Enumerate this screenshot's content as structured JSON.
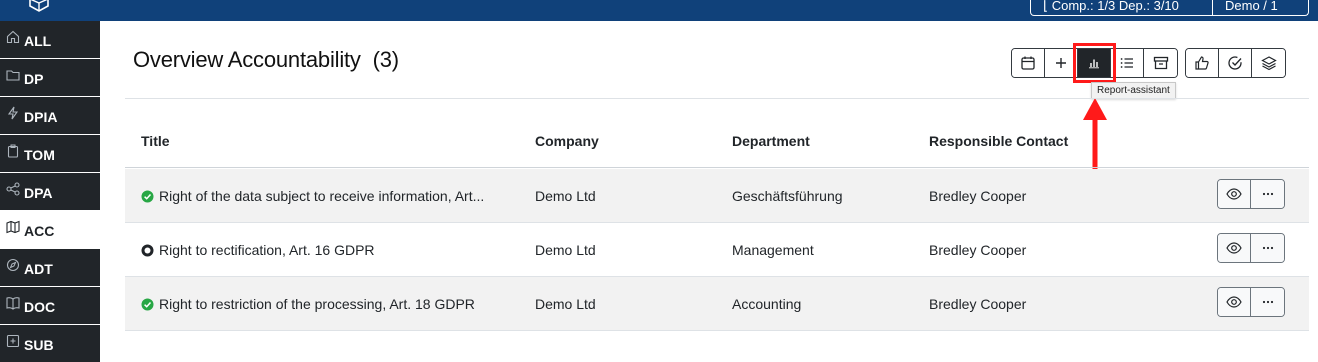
{
  "header": {
    "company_selector": "Comp.: 1/3 Dep.: 3/10",
    "user_menu": "Demo / 1"
  },
  "sidebar": {
    "items": [
      {
        "label": "ALL",
        "icon": "home-icon",
        "active": false
      },
      {
        "label": "DP",
        "icon": "folder-icon",
        "active": false
      },
      {
        "label": "DPIA",
        "icon": "lightning-icon",
        "active": false
      },
      {
        "label": "TOM",
        "icon": "clipboard-icon",
        "active": false
      },
      {
        "label": "DPA",
        "icon": "share-nodes-icon",
        "active": false
      },
      {
        "label": "ACC",
        "icon": "map-icon",
        "active": true
      },
      {
        "label": "ADT",
        "icon": "compass-icon",
        "active": false
      },
      {
        "label": "DOC",
        "icon": "book-icon",
        "active": false
      },
      {
        "label": "SUB",
        "icon": "folder-plus-icon",
        "active": false
      }
    ]
  },
  "page": {
    "title": "Overview Accountability",
    "count": "(3)"
  },
  "toolbar": {
    "tooltip": "Report-assistant",
    "highlight_color": "#ff1a1a",
    "buttons": [
      "calendar-icon",
      "plus-icon",
      "bar-chart-icon",
      "list-icon",
      "archive-icon",
      "thumbs-up-icon",
      "check-circle-icon",
      "layers-icon"
    ]
  },
  "table": {
    "headers": [
      "Title",
      "Company",
      "Department",
      "Responsible Contact"
    ],
    "rows": [
      {
        "status": "complete",
        "title": "Right of the data subject to receive information, Art...",
        "company": "Demo Ltd",
        "department": "Geschäftsführung",
        "contact": "Bredley Cooper"
      },
      {
        "status": "open",
        "title": "Right to rectification, Art. 16 GDPR",
        "company": "Demo Ltd",
        "department": "Management",
        "contact": "Bredley Cooper"
      },
      {
        "status": "complete",
        "title": "Right to restriction of the processing, Art. 18 GDPR",
        "company": "Demo Ltd",
        "department": "Accounting",
        "contact": "Bredley Cooper"
      }
    ]
  },
  "colors": {
    "topbar": "#10417a",
    "sidebar": "#212529",
    "status_complete": "#28a745",
    "status_open": "#212529"
  }
}
